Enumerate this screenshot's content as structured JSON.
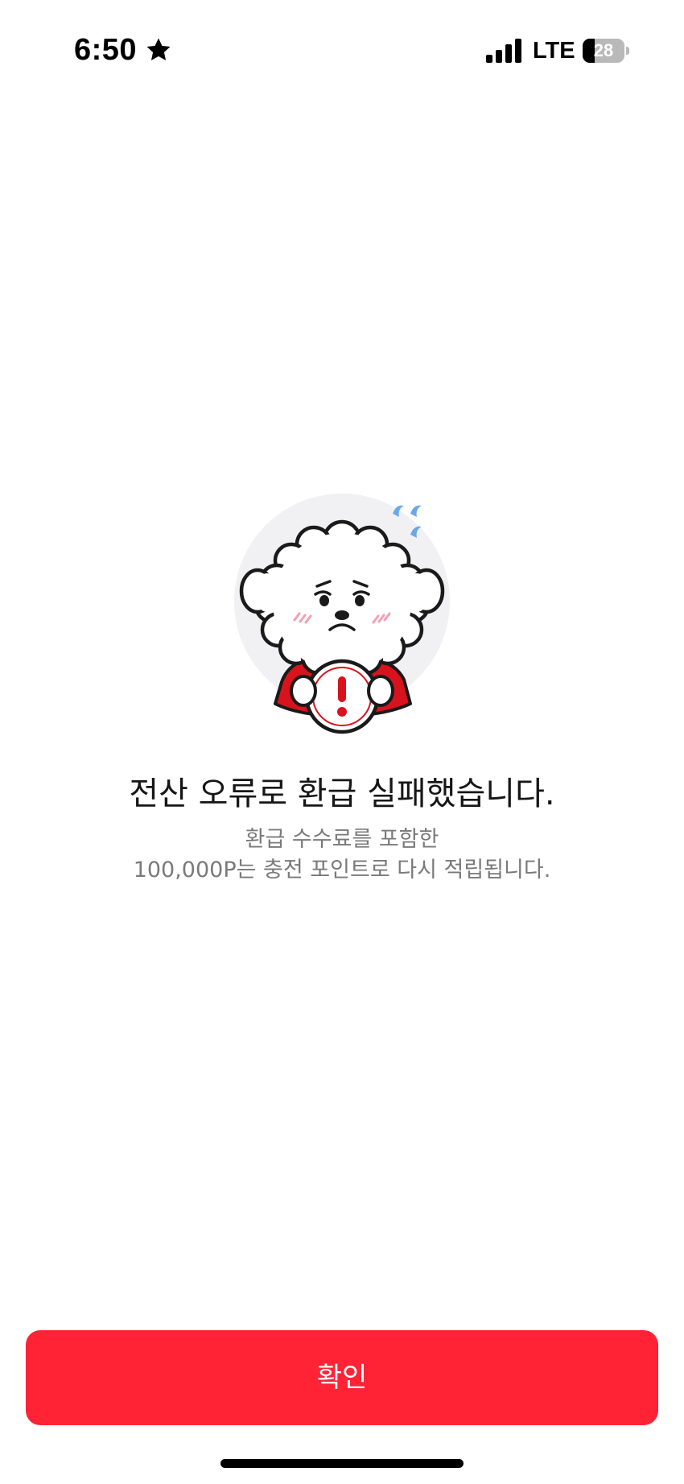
{
  "status_bar": {
    "time": "6:50",
    "status_icon": "star-icon",
    "network": "LTE",
    "battery_level": "28",
    "battery_percent": 28
  },
  "illustration": {
    "icon": "sad-poodle-mascot-warning",
    "badge_symbol": "!"
  },
  "message": {
    "title": "전산 오류로 환급 실패했습니다.",
    "description_line1": "환급 수수료를 포함한",
    "description_line2": "100,000P는 충전 포인트로 다시 적립됩니다."
  },
  "actions": {
    "confirm_label": "확인"
  },
  "colors": {
    "accent": "#ff2335",
    "title_text": "#161616",
    "description_text": "#7a7a7a",
    "mascot_circle": "#f1f1f3",
    "sweat_drop": "#6aa8e8",
    "mascot_shirt": "#d8131e"
  }
}
